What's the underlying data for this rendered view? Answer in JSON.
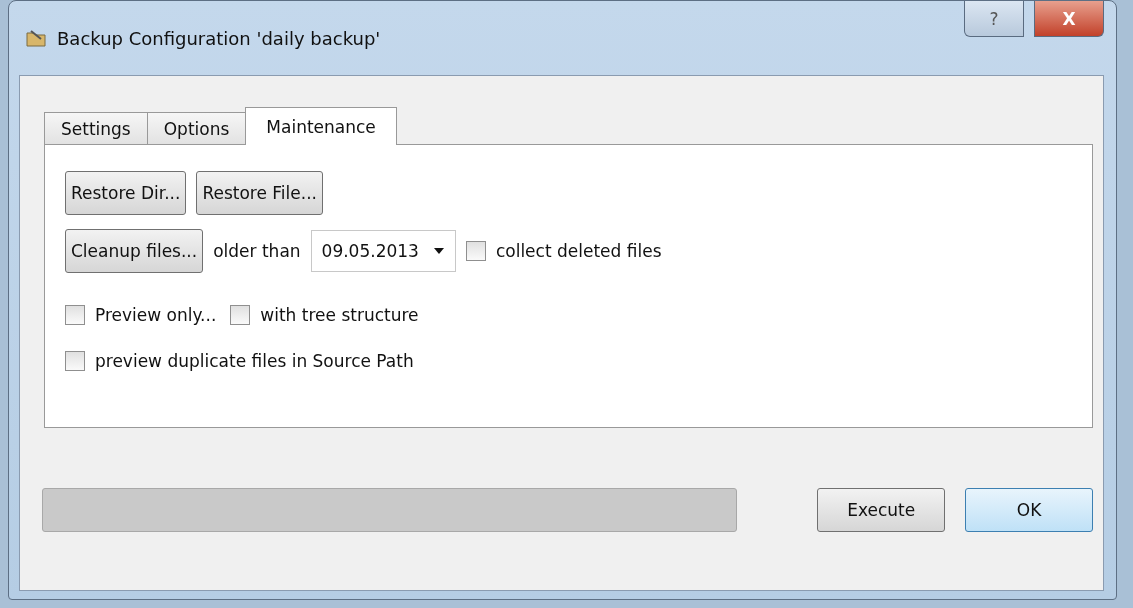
{
  "window": {
    "title": "Backup Configuration 'daily backup'",
    "help": "?",
    "close": "X"
  },
  "tabs": [
    {
      "label": "Settings",
      "selected": false
    },
    {
      "label": "Options",
      "selected": false
    },
    {
      "label": "Maintenance",
      "selected": true
    }
  ],
  "restore_buttons": [
    "Restore Dir...",
    "Restore File..."
  ],
  "cleanup": {
    "button": "Cleanup files...",
    "label": "older than",
    "date": "09.05.2013",
    "collect": {
      "label": "collect deleted files",
      "checked": false
    }
  },
  "options_row": [
    {
      "label": "Preview only...",
      "checked": false
    },
    {
      "label": "with tree structure",
      "checked": false
    }
  ],
  "duplicates": {
    "label": "preview duplicate files in Source Path",
    "checked": false
  },
  "progress": {
    "level": 0
  },
  "buttons": [
    {
      "label": "Execute",
      "default": false
    },
    {
      "label": "OK",
      "default": true
    }
  ]
}
